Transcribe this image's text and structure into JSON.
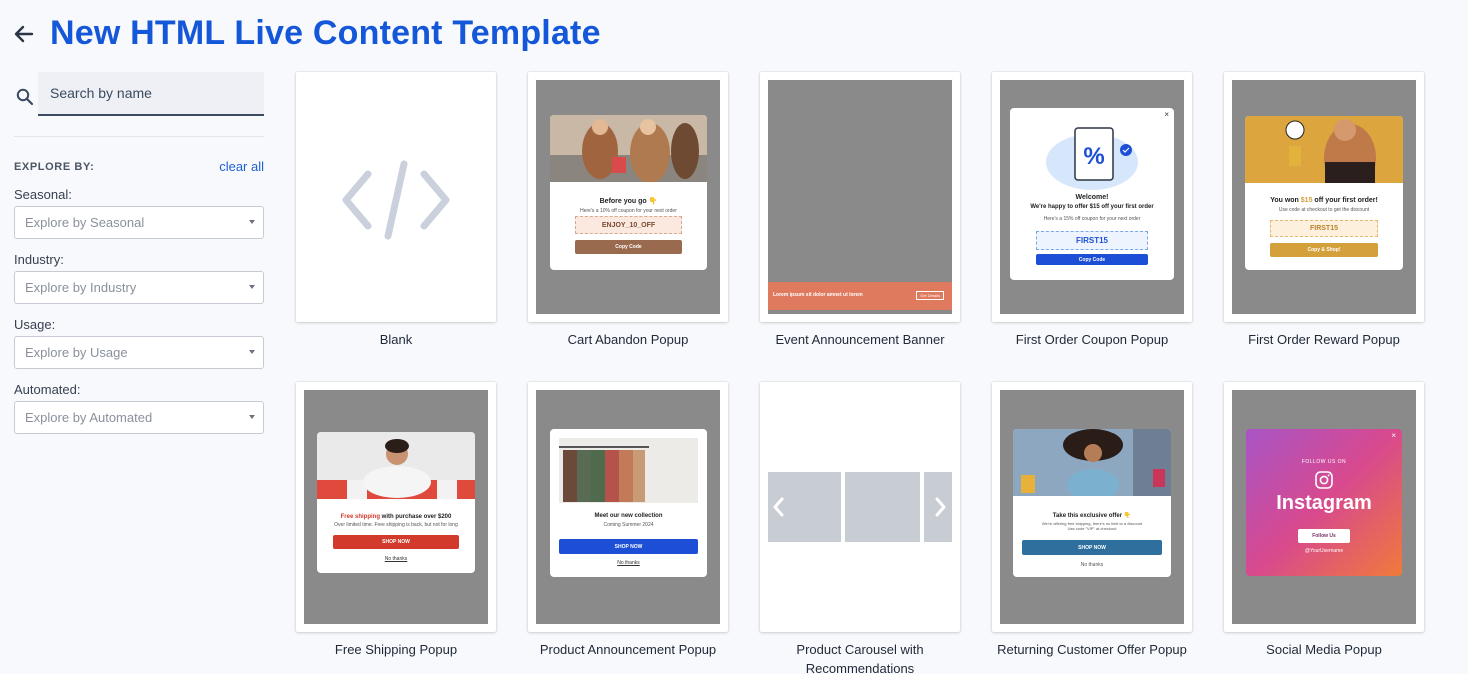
{
  "header": {
    "title": "New HTML Live Content Template"
  },
  "search": {
    "placeholder": "Search by name"
  },
  "explore": {
    "label": "EXPLORE BY:",
    "clear_all": "clear all",
    "filters": [
      {
        "label": "Seasonal:",
        "placeholder": "Explore by Seasonal"
      },
      {
        "label": "Industry:",
        "placeholder": "Explore by Industry"
      },
      {
        "label": "Usage:",
        "placeholder": "Explore by Usage"
      },
      {
        "label": "Automated:",
        "placeholder": "Explore by Automated"
      }
    ]
  },
  "templates": [
    {
      "name": "Blank"
    },
    {
      "name": "Cart Abandon Popup",
      "preview": {
        "heading": "Before you go 👇",
        "text": "Here's a 10% off coupon for your next order",
        "code": "ENJOY_10_OFF",
        "button": "Copy Code"
      }
    },
    {
      "name": "Event Announcement Banner",
      "preview": {
        "text": "Lorem ipsum sit dolor amnet ut lorem",
        "button": "Get Details"
      }
    },
    {
      "name": "First Order Coupon Popup",
      "preview": {
        "welcome": "Welcome!",
        "heading": "We're happy to offer $15 off your first order",
        "text": "Here's a 15% off coupon for your next order",
        "code": "FIRST15",
        "button": "Copy Code"
      }
    },
    {
      "name": "First Order Reward Popup",
      "preview": {
        "heading": "You won $15 off your first order!",
        "text": "Use code at checkout to get the discount",
        "code": "FIRST15",
        "button": "Copy & Shop!"
      }
    },
    {
      "name": "Free Shipping Popup",
      "preview": {
        "heading_accent": "Free shipping",
        "heading": " with purchase over $200",
        "text": "Over limited time. Free shipping is back, but not for long",
        "button": "SHOP NOW",
        "link": "No thanks"
      }
    },
    {
      "name": "Product Announcement Popup",
      "preview": {
        "heading": "Meet our new collection",
        "text": "Coming Summer 2024",
        "button": "SHOP NOW",
        "link": "No thanks"
      }
    },
    {
      "name": "Product Carousel with Recommendations"
    },
    {
      "name": "Returning Customer Offer Popup",
      "preview": {
        "heading": "Take this exclusive offer 👇",
        "text": "We're offering free shipping, there's no limit to a discount",
        "text2": "Use code \"VIP\" at checkout",
        "button": "SHOP NOW",
        "link": "No thanks"
      }
    },
    {
      "name": "Social Media Popup",
      "preview": {
        "eyebrow": "FOLLOW US ON",
        "brand": "Instagram",
        "button": "Follow Us",
        "handle": "@YourUsername"
      }
    }
  ],
  "colors": {
    "title": "#1457d9",
    "link": "#1d5fd6",
    "preview_grey": "#8a8a8a",
    "cart_button": "#9a6a4f",
    "event_banner": "#e07a5f",
    "coupon_button": "#1d4fd6",
    "reward_button": "#d4a03c",
    "shipping_button": "#d23a2c",
    "returning_button": "#2e6f9e"
  }
}
